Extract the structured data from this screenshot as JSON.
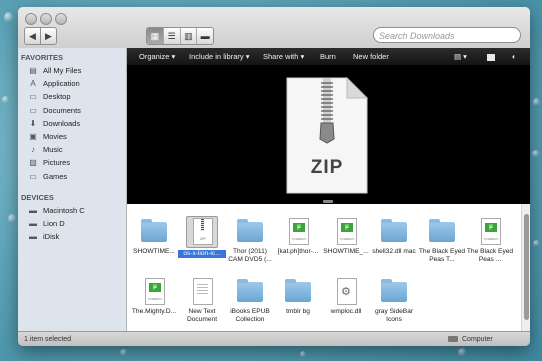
{
  "window": {
    "search_placeholder": "Search Downloads",
    "nav_back": "◀",
    "nav_forward": "▶"
  },
  "sidebar": {
    "favorites_heading": "FAVORITES",
    "favorites": [
      {
        "label": "All My Files",
        "icon": "all-files-icon"
      },
      {
        "label": "Application",
        "icon": "applications-icon"
      },
      {
        "label": "Desktop",
        "icon": "desktop-icon"
      },
      {
        "label": "Documents",
        "icon": "documents-icon"
      },
      {
        "label": "Downloads",
        "icon": "downloads-icon"
      },
      {
        "label": "Movies",
        "icon": "movies-icon"
      },
      {
        "label": "Music",
        "icon": "music-icon"
      },
      {
        "label": "Pictures",
        "icon": "pictures-icon"
      },
      {
        "label": "Games",
        "icon": "games-icon"
      }
    ],
    "devices_heading": "DEVICES",
    "devices": [
      {
        "label": "Macintosh C",
        "icon": "hard-drive-icon"
      },
      {
        "label": "Lion D",
        "icon": "hard-drive-icon"
      },
      {
        "label": "iDisk",
        "icon": "idisk-icon"
      }
    ]
  },
  "toolbar": {
    "organize": "Organize ▾",
    "include_in_library": "Include in library ▾",
    "share_with": "Share with ▾",
    "burn": "Burn",
    "new_folder": "New folder"
  },
  "preview": {
    "label": "ZIP"
  },
  "files": [
    {
      "name": "SHOWTIME...",
      "type": "folder",
      "selected": false
    },
    {
      "name": "os-x-lion-ic...",
      "type": "zip",
      "selected": true
    },
    {
      "name": "Thor (2011) CAM DVD5 (...",
      "type": "folder",
      "selected": false
    },
    {
      "name": "[kat.ph]thor-...",
      "type": "torrent",
      "selected": false
    },
    {
      "name": "SHOWTIME_...",
      "type": "torrent",
      "selected": false
    },
    {
      "name": "shell32.dll mac",
      "type": "folder",
      "selected": false
    },
    {
      "name": "The Black Eyed Peas T...",
      "type": "folder",
      "selected": false
    },
    {
      "name": "The Black Eyed Peas ...",
      "type": "torrent",
      "selected": false
    },
    {
      "name": "The.Mighty.D...",
      "type": "torrent",
      "selected": false
    },
    {
      "name": "New Text Document",
      "type": "text",
      "selected": false
    },
    {
      "name": "iBooks EPUB Collection",
      "type": "folder",
      "selected": false
    },
    {
      "name": "tmblr bg",
      "type": "folder",
      "selected": false
    },
    {
      "name": "wmploc.dll",
      "type": "dll",
      "selected": false
    },
    {
      "name": "gray SideBar Icons",
      "type": "folder",
      "selected": false
    }
  ],
  "icon_text": {
    "zip": "ZIP",
    "torrent": "TORRENT"
  },
  "status": {
    "left": "1 item selected",
    "right": "Computer"
  },
  "colors": {
    "selection": "#3875d7",
    "toolbar": "#1e1e1e",
    "sidebar": "#dde4ec"
  }
}
